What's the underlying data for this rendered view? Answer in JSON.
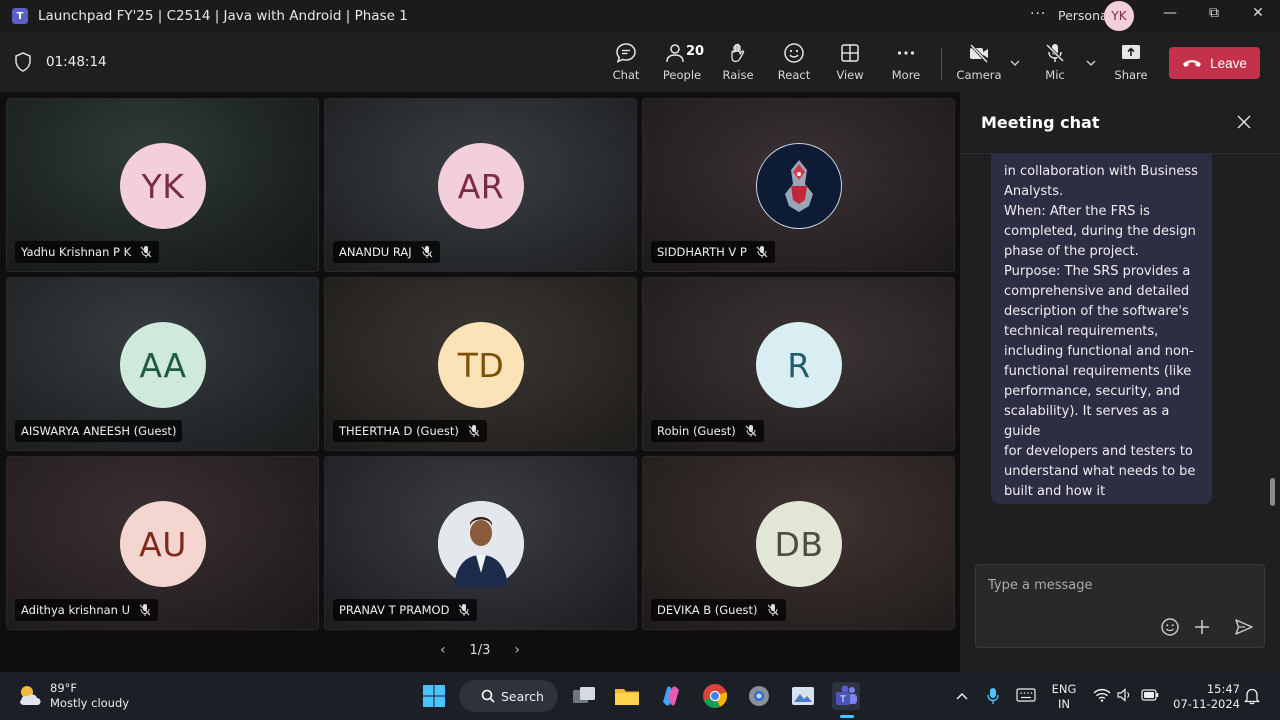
{
  "window": {
    "title": "Launchpad FY'25 | C2514 | Java with Android | Phase 1",
    "more": "···",
    "account_label": "Personal",
    "account_initials": "YK",
    "minimize": "—",
    "maximize": "⧉",
    "close": "✕"
  },
  "toolbar": {
    "timer": "01:48:14",
    "chat_label": "Chat",
    "people_label": "People",
    "people_count": "20",
    "raise_label": "Raise",
    "react_label": "React",
    "view_label": "View",
    "more_label": "More",
    "camera_label": "Camera",
    "mic_label": "Mic",
    "share_label": "Share",
    "leave_label": "Leave"
  },
  "participants": [
    {
      "initials": "YK",
      "name": "Yadhu Krishnan P K",
      "avatar_bg": "#f3cfdc",
      "avatar_fg": "#7b2a4a"
    },
    {
      "initials": "AR",
      "name": "ANANDU RAJ",
      "avatar_bg": "#f3cfdc",
      "avatar_fg": "#7b2a4a"
    },
    {
      "initials": "",
      "name": "SIDDHARTH V P",
      "avatar_bg": "#0d1b34",
      "avatar_fg": "#ffffff"
    },
    {
      "initials": "AA",
      "name": "AISWARYA ANEESH (Guest)",
      "avatar_bg": "#cfe9dc",
      "avatar_fg": "#1e5c3e"
    },
    {
      "initials": "TD",
      "name": "THEERTHA D (Guest)",
      "avatar_bg": "#fbe3b8",
      "avatar_fg": "#7a5205"
    },
    {
      "initials": "R",
      "name": "Robin (Guest)",
      "avatar_bg": "#d9eef2",
      "avatar_fg": "#235d69"
    },
    {
      "initials": "AU",
      "name": "Adithya krishnan U",
      "avatar_bg": "#f5d5cf",
      "avatar_fg": "#7e2b1c"
    },
    {
      "initials": "",
      "name": "PRANAV T PRAMOD",
      "avatar_bg": "#d8dde3",
      "avatar_fg": "#333333"
    },
    {
      "initials": "DB",
      "name": "DEVIKA B (Guest)",
      "avatar_bg": "#e2e6d7",
      "avatar_fg": "#4a4f3a"
    }
  ],
  "pager": {
    "prev": "‹",
    "label": "1/3",
    "next": "›"
  },
  "chat": {
    "title": "Meeting chat",
    "message": "in collaboration with Business\nAnalysts.\nWhen: After the FRS is\ncompleted, during the design\nphase of the project.\nPurpose: The SRS provides a\ncomprehensive and detailed\ndescription of the software's\ntechnical requirements,\nincluding functional and non-\nfunctional requirements (like\nperformance, security, and\nscalability). It serves as a guide\nfor developers and testers to\nunderstand what needs to be\nbuilt and how it\nshould function.",
    "placeholder": "Type a message"
  },
  "taskbar": {
    "temperature": "89°F",
    "weather": "Mostly cloudy",
    "search_label": "Search",
    "lang_top": "ENG",
    "lang_bottom": "IN",
    "time": "15:47",
    "date": "07-11-2024"
  },
  "colors": {
    "accent": "#7f85f5",
    "leave": "#c4314b",
    "bubble": "#2d2d44"
  }
}
